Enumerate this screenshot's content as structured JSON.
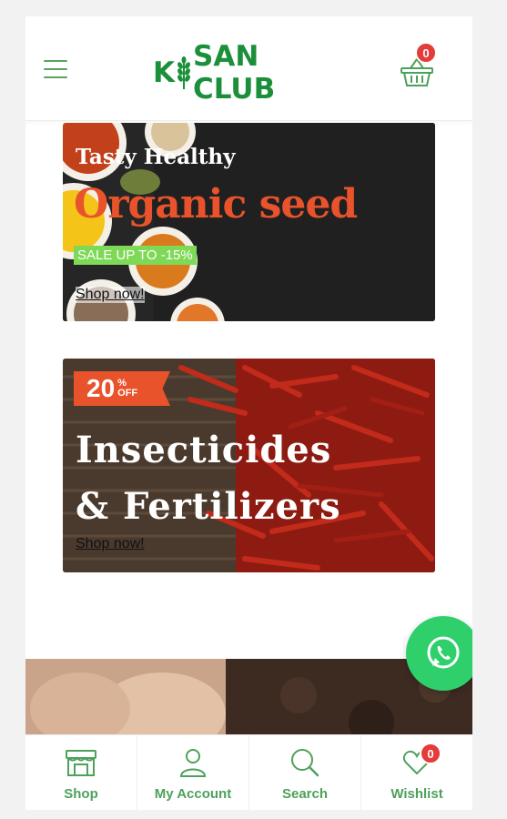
{
  "header": {
    "logo_text_before": "K",
    "logo_text_after": "SAN CLUB",
    "cart_count": "0"
  },
  "banners": [
    {
      "tagline": "Tasty Healthy",
      "title": "Organic seed",
      "sale": "SALE UP TO -15%",
      "cta": "Shop now!"
    },
    {
      "discount_number": "20",
      "discount_symbol": "%",
      "discount_word": "OFF",
      "title_line1": "Insecticides",
      "title_line2": "& Fertilizers",
      "cta": "Shop now!"
    }
  ],
  "bottom_nav": {
    "items": [
      {
        "label": "Shop",
        "icon": "shop-icon"
      },
      {
        "label": "My Account",
        "icon": "user-icon"
      },
      {
        "label": "Search",
        "icon": "search-icon"
      },
      {
        "label": "Wishlist",
        "icon": "heart-icon"
      }
    ],
    "wishlist_count": "0"
  },
  "colors": {
    "brand_green": "#1c8f3a",
    "nav_green": "#4da15a",
    "accent_orange": "#e8532c",
    "badge_red": "#e43b3b",
    "whatsapp_green": "#2fd06b"
  }
}
